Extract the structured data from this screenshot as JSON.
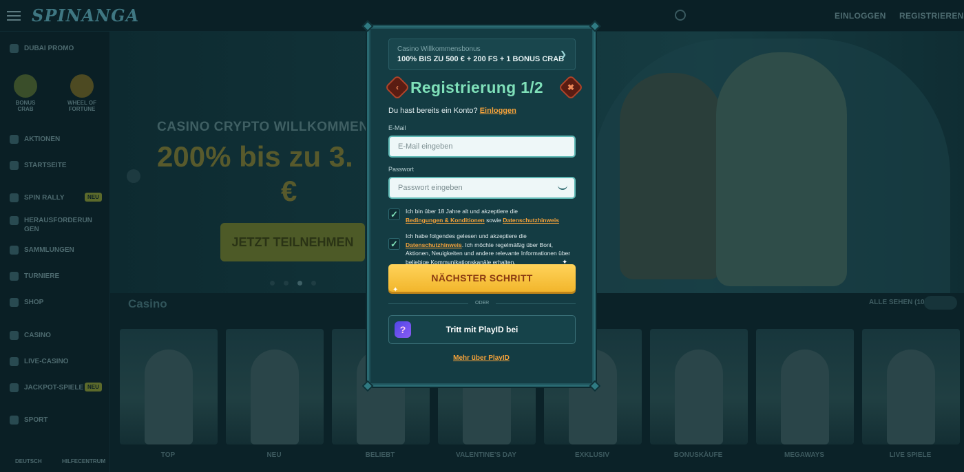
{
  "header": {
    "logo": "SPINANGA",
    "login": "EINLOGGEN",
    "register": "REGISTRIEREN"
  },
  "sidebar": {
    "promo": "DUBAI PROMO",
    "tiles": [
      {
        "label": "BONUS CRAB"
      },
      {
        "label": "WHEEL OF FORTUNE"
      }
    ],
    "items": [
      {
        "label": "AKTIONEN"
      },
      {
        "label": "STARTSEITE"
      },
      {
        "label": "SPIN RALLY",
        "badge": "NEU"
      },
      {
        "label": "HERAUSFORDERUNGEN"
      },
      {
        "label": "SAMMLUNGEN"
      },
      {
        "label": "TURNIERE"
      },
      {
        "label": "SHOP"
      },
      {
        "label": "CASINO"
      },
      {
        "label": "LIVE-CASINO"
      },
      {
        "label": "JACKPOT-SPIELE",
        "badge": "NEU"
      },
      {
        "label": "SPORT"
      }
    ],
    "bottom": {
      "language": "DEUTSCH",
      "help": "HILFECENTRUM"
    }
  },
  "hero": {
    "subtitle": "CASINO CRYPTO WILLKOMMEN",
    "headline": "200% bis zu 3.",
    "headline2": "€",
    "cta": "JETZT TEILNEHMEN"
  },
  "casino": {
    "title": "Casino",
    "see_all": "ALLE SEHEN (10)",
    "tabs": [
      "TOP",
      "NEU",
      "BELIEBT",
      "VALENTINE'S DAY",
      "EXKLUSIV",
      "BONUSKÄUFE",
      "MEGAWAYS",
      "LIVE SPIELE"
    ]
  },
  "modal": {
    "bonus": {
      "label": "Casino Willkommensbonus",
      "value": "100% BIS ZU 500 € + 200 FS + 1 BONUS CRAB"
    },
    "title": "Registrierung 1/2",
    "has_account": "Du hast bereits ein Konto?",
    "login_link": "Einloggen",
    "email": {
      "label": "E-Mail",
      "placeholder": "E-Mail eingeben"
    },
    "password": {
      "label": "Passwort",
      "placeholder": "Passwort eingeben"
    },
    "consent1": {
      "pre": "Ich bin über 18 Jahre alt und akzeptiere die",
      "link1": "Bedingungen & Konditionen",
      "mid": "sowie",
      "link2": "Datenschutzhinweis",
      "checked": true
    },
    "consent2": {
      "pre": "Ich habe folgendes gelesen und akzeptiere die",
      "link": "Datenschutzhinweis",
      "post": ". Ich möchte regelmäßig über Boni, Aktionen, Neuigkeiten und andere relevante Informationen über beliebige Kommunikationskanäle erhalten.",
      "checked": true
    },
    "next_button": "NÄCHSTER SCHRITT",
    "or": "ODER",
    "playid_button": "Tritt mit PlayID bei",
    "more_link": "Mehr über PlayID"
  },
  "colors": {
    "accent_green": "#7fe0b9",
    "accent_orange": "#f5a23a",
    "button_yellow": "#f2b62c"
  }
}
